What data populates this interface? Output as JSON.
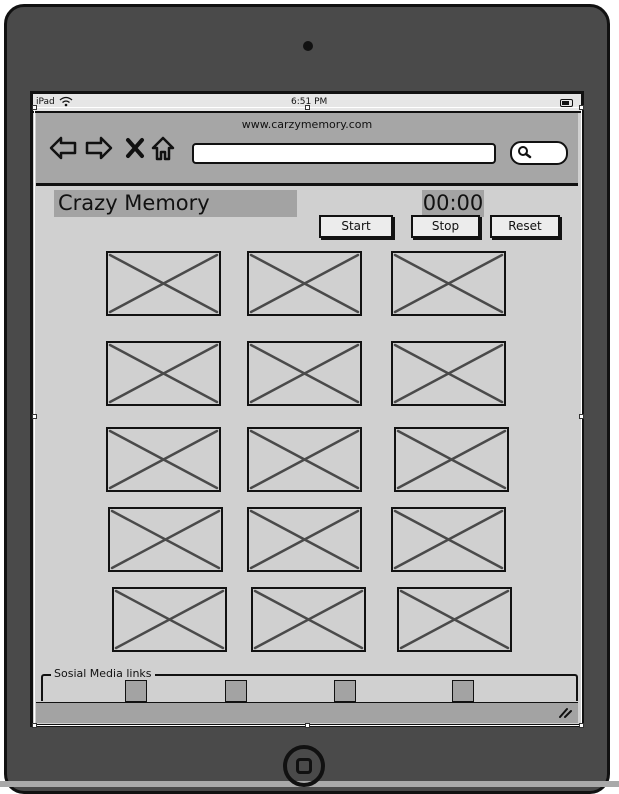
{
  "status": {
    "device": "iPad",
    "time": "6:51 PM"
  },
  "browser": {
    "url": "www.carzymemory.com"
  },
  "app": {
    "title": "Crazy Memory",
    "timer": "00:00",
    "buttons": {
      "start": "Start",
      "stop": "Stop",
      "reset": "Reset"
    }
  },
  "board": {
    "rows": 5,
    "cols": 3,
    "card_icon": "image-placeholder-icon"
  },
  "social": {
    "legend": "Sosial Media links",
    "items": 4
  },
  "colors": {
    "device": "#4a4a4a",
    "screen": "#d0d0d0",
    "bar": "#a6a6a6",
    "title_bg": "#a3a3a3"
  }
}
